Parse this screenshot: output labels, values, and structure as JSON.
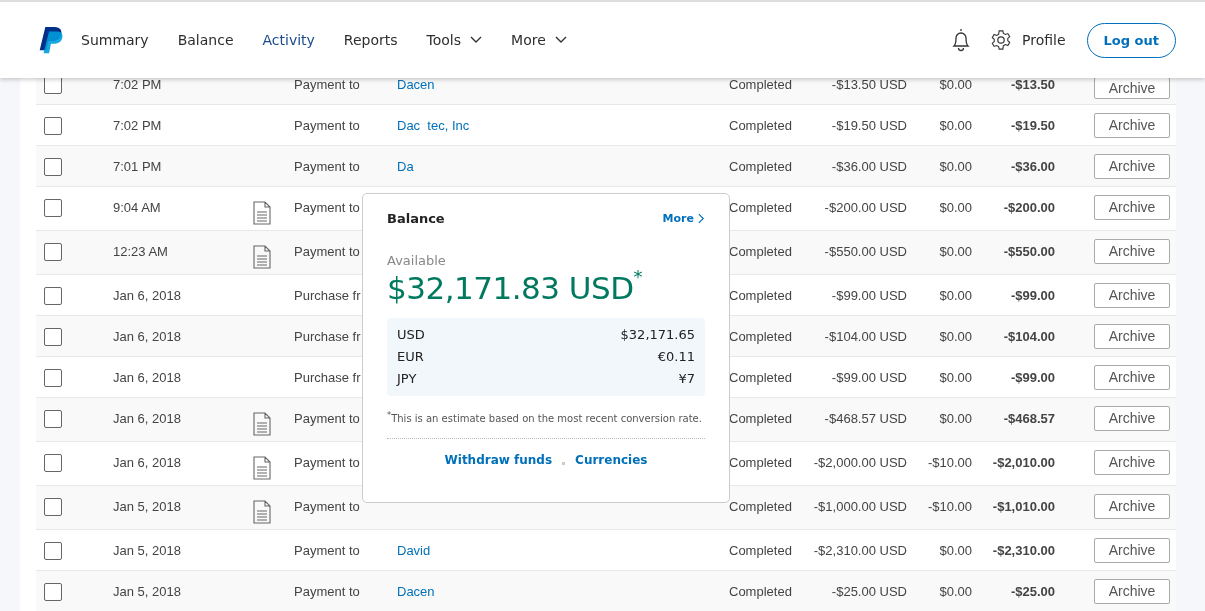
{
  "nav": {
    "items": [
      {
        "label": "Summary",
        "selected": false,
        "dropdown": false
      },
      {
        "label": "Balance",
        "selected": false,
        "dropdown": false
      },
      {
        "label": "Activity",
        "selected": true,
        "dropdown": false
      },
      {
        "label": "Reports",
        "selected": false,
        "dropdown": false
      },
      {
        "label": "Tools",
        "selected": false,
        "dropdown": true
      },
      {
        "label": "More",
        "selected": false,
        "dropdown": true
      }
    ],
    "profile": "Profile",
    "logout": "Log out"
  },
  "rows": [
    {
      "checked": false,
      "time": "7:02 PM",
      "receipt": false,
      "description": "Payment to",
      "name": "Dacen",
      "status": "Completed",
      "amount": "-$13.50 USD",
      "fee": "$0.00",
      "net": "-$13.50",
      "action": "Archive"
    },
    {
      "checked": false,
      "time": "7:02 PM",
      "receipt": false,
      "description": "Payment to",
      "name": "Dac  tec, Inc",
      "status": "Completed",
      "amount": "-$19.50 USD",
      "fee": "$0.00",
      "net": "-$19.50",
      "action": "Archive"
    },
    {
      "checked": false,
      "time": "7:01 PM",
      "receipt": false,
      "description": "Payment to",
      "name": "Da",
      "status": "Completed",
      "amount": "-$36.00 USD",
      "fee": "$0.00",
      "net": "-$36.00",
      "action": "Archive"
    },
    {
      "checked": false,
      "time": "9:04 AM",
      "receipt": true,
      "description": "Payment to",
      "status": "Completed",
      "amount": "-$200.00 USD",
      "fee": "$0.00",
      "net": "-$200.00",
      "action": "Archive"
    },
    {
      "checked": false,
      "time": "12:23 AM",
      "receipt": true,
      "description": "Payment to",
      "status": "Completed",
      "amount": "-$550.00 USD",
      "fee": "$0.00",
      "net": "-$550.00",
      "action": "Archive"
    },
    {
      "checked": false,
      "time": "Jan 6, 2018",
      "receipt": false,
      "description": "Purchase fr",
      "status": "Completed",
      "amount": "-$99.00 USD",
      "fee": "$0.00",
      "net": "-$99.00",
      "action": "Archive"
    },
    {
      "checked": false,
      "time": "Jan 6, 2018",
      "receipt": false,
      "description": "Purchase fr",
      "status": "Completed",
      "amount": "-$104.00 USD",
      "fee": "$0.00",
      "net": "-$104.00",
      "action": "Archive"
    },
    {
      "checked": false,
      "time": "Jan 6, 2018",
      "receipt": false,
      "description": "Purchase fr",
      "status": "Completed",
      "amount": "-$99.00 USD",
      "fee": "$0.00",
      "net": "-$99.00",
      "action": "Archive"
    },
    {
      "checked": false,
      "time": "Jan 6, 2018",
      "receipt": true,
      "description": "Payment to",
      "status": "Completed",
      "amount": "-$468.57 USD",
      "fee": "$0.00",
      "net": "-$468.57",
      "action": "Archive"
    },
    {
      "checked": false,
      "time": "Jan 6, 2018",
      "receipt": true,
      "description": "Payment to",
      "status": "Completed",
      "amount": "-$2,000.00 USD",
      "fee": "-$10.00",
      "net": "-$2,010.00",
      "action": "Archive"
    },
    {
      "checked": false,
      "time": "Jan 5, 2018",
      "receipt": true,
      "description": "Payment to",
      "status": "Completed",
      "amount": "-$1,000.00 USD",
      "fee": "-$10.00",
      "net": "-$1,010.00",
      "action": "Archive"
    },
    {
      "checked": false,
      "time": "Jan 5, 2018",
      "receipt": false,
      "description": "Payment to",
      "name": "David",
      "status": "Completed",
      "amount": "-$2,310.00 USD",
      "fee": "$0.00",
      "net": "-$2,310.00",
      "action": "Archive"
    },
    {
      "checked": false,
      "time": "Jan 5, 2018",
      "receipt": false,
      "description": "Payment to",
      "name": "Dacen",
      "status": "Completed",
      "amount": "-$25.00 USD",
      "fee": "$0.00",
      "net": "-$25.00",
      "action": "Archive"
    }
  ],
  "balance_popup": {
    "title": "Balance",
    "more": "More",
    "available_label": "Available",
    "total": "$32,171.83 USD",
    "total_mark": "*",
    "currencies": [
      {
        "code": "USD",
        "amount": "$32,171.65"
      },
      {
        "code": "EUR",
        "amount": "€0.11"
      },
      {
        "code": "JPY",
        "amount": "¥7"
      }
    ],
    "note": "$^{*}$This is an estimate based on the most recent conversion rate.",
    "links": [
      "Withdraw funds",
      "Currencies"
    ]
  }
}
